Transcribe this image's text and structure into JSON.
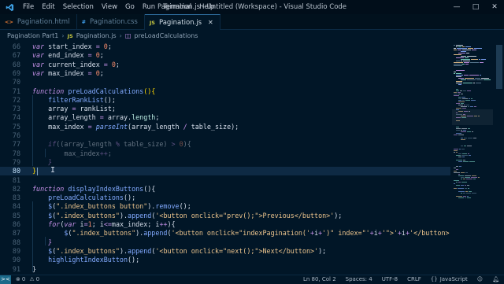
{
  "window": {
    "title": "Pagination.js - Untitled (Workspace) - Visual Studio Code"
  },
  "menu": [
    "File",
    "Edit",
    "Selection",
    "View",
    "Go",
    "Run",
    "Terminal",
    "Help"
  ],
  "tabs": [
    {
      "label": "Pagination.html",
      "icon": "html-file-icon",
      "active": false
    },
    {
      "label": "Pagination.css",
      "icon": "css-file-icon",
      "active": false
    },
    {
      "label": "Pagination.js",
      "icon": "js-file-icon",
      "active": true
    }
  ],
  "breadcrumbs": [
    "Pagination Part1",
    "Pagination.js",
    "preLoadCalculations"
  ],
  "editor": {
    "current_line": 80,
    "lines": [
      {
        "n": "66",
        "tokens": [
          [
            "kw",
            "var"
          ],
          [
            "vr",
            " start_index "
          ],
          [
            "op",
            "="
          ],
          [
            "pn",
            " "
          ],
          [
            "num",
            "0"
          ],
          [
            "pn",
            ";"
          ]
        ]
      },
      {
        "n": "67",
        "tokens": [
          [
            "kw",
            "var"
          ],
          [
            "vr",
            " end_index "
          ],
          [
            "op",
            "="
          ],
          [
            "pn",
            " "
          ],
          [
            "num",
            "0"
          ],
          [
            "pn",
            ";"
          ]
        ]
      },
      {
        "n": "68",
        "tokens": [
          [
            "kw",
            "var"
          ],
          [
            "vr",
            " current_index "
          ],
          [
            "op",
            "="
          ],
          [
            "pn",
            " "
          ],
          [
            "num",
            "0"
          ],
          [
            "pn",
            ";"
          ]
        ]
      },
      {
        "n": "69",
        "tokens": [
          [
            "kw",
            "var"
          ],
          [
            "vr",
            " max_index "
          ],
          [
            "op",
            "="
          ],
          [
            "pn",
            " "
          ],
          [
            "num",
            "0"
          ],
          [
            "pn",
            ";"
          ]
        ]
      },
      {
        "n": "70",
        "tokens": []
      },
      {
        "n": "71",
        "tokens": [
          [
            "kw",
            "function"
          ],
          [
            "pn",
            " "
          ],
          [
            "fn",
            "preLoadCalculations"
          ],
          [
            "br",
            "()"
          ],
          [
            "br",
            "{"
          ]
        ]
      },
      {
        "n": "72",
        "tokens": [
          [
            "pn",
            "    "
          ],
          [
            "fn",
            "filterRankList"
          ],
          [
            "pn",
            "();"
          ]
        ]
      },
      {
        "n": "73",
        "tokens": [
          [
            "pn",
            "    "
          ],
          [
            "vr",
            "array "
          ],
          [
            "op",
            "="
          ],
          [
            "vr",
            " rankList"
          ],
          [
            "pn",
            ";"
          ]
        ]
      },
      {
        "n": "74",
        "tokens": [
          [
            "pn",
            "    "
          ],
          [
            "vr",
            "array_length "
          ],
          [
            "op",
            "="
          ],
          [
            "vr",
            " array"
          ],
          [
            "pn",
            "."
          ],
          [
            "pr",
            "length"
          ],
          [
            "pn",
            ";"
          ]
        ]
      },
      {
        "n": "75",
        "tokens": [
          [
            "pn",
            "    "
          ],
          [
            "vr",
            "max_index "
          ],
          [
            "op",
            "="
          ],
          [
            "pn",
            " "
          ],
          [
            "fnc",
            "parseInt"
          ],
          [
            "pn",
            "(array_length "
          ],
          [
            "op",
            "/"
          ],
          [
            "pn",
            " table_size);"
          ]
        ]
      },
      {
        "n": "76",
        "tokens": []
      },
      {
        "n": "77",
        "tokens": [
          [
            "pn",
            "    "
          ],
          [
            "kw",
            "if"
          ],
          [
            "pn",
            "((array_length "
          ],
          [
            "op",
            "%"
          ],
          [
            "pn",
            " table_size) "
          ],
          [
            "op",
            ">"
          ],
          [
            "pn",
            " "
          ],
          [
            "num",
            "0"
          ],
          [
            "pn",
            "){"
          ]
        ],
        "dim": true
      },
      {
        "n": "78",
        "tokens": [
          [
            "pn",
            "        "
          ],
          [
            "vr",
            "max_index"
          ],
          [
            "op",
            "++"
          ],
          [
            "pn",
            ";"
          ]
        ],
        "dim": true
      },
      {
        "n": "79",
        "tokens": [
          [
            "pn",
            "    "
          ],
          [
            "kw",
            "}"
          ]
        ],
        "dim": true
      },
      {
        "n": "80",
        "tokens": [
          [
            "br",
            "}"
          ]
        ]
      },
      {
        "n": "81",
        "tokens": []
      },
      {
        "n": "82",
        "tokens": [
          [
            "kw",
            "function"
          ],
          [
            "pn",
            " "
          ],
          [
            "fn",
            "displayIndexButtons"
          ],
          [
            "pn",
            "(){"
          ]
        ]
      },
      {
        "n": "83",
        "tokens": [
          [
            "pn",
            "    "
          ],
          [
            "fn",
            "preLoadCalculations"
          ],
          [
            "pn",
            "();"
          ]
        ]
      },
      {
        "n": "84",
        "tokens": [
          [
            "pn",
            "    "
          ],
          [
            "fn",
            "$"
          ],
          [
            "pn",
            "("
          ],
          [
            "str",
            "\".index_buttons button\""
          ],
          [
            "pn",
            ")."
          ],
          [
            "fn",
            "remove"
          ],
          [
            "pn",
            "();"
          ]
        ]
      },
      {
        "n": "85",
        "tokens": [
          [
            "pn",
            "    "
          ],
          [
            "fn",
            "$"
          ],
          [
            "pn",
            "("
          ],
          [
            "str",
            "\".index_buttons\""
          ],
          [
            "pn",
            ")."
          ],
          [
            "fn",
            "append"
          ],
          [
            "pn",
            "("
          ],
          [
            "str",
            "'<button onclick=\"prev();\">Previous</button>'"
          ],
          [
            "pn",
            ");"
          ]
        ]
      },
      {
        "n": "86",
        "tokens": [
          [
            "pn",
            "    "
          ],
          [
            "kw",
            "for"
          ],
          [
            "pn",
            "("
          ],
          [
            "kw",
            "var"
          ],
          [
            "pn",
            " i"
          ],
          [
            "op",
            "="
          ],
          [
            "num",
            "1"
          ],
          [
            "pn",
            "; i"
          ],
          [
            "op",
            "<="
          ],
          [
            "pn",
            "max_index; i"
          ],
          [
            "op",
            "++"
          ],
          [
            "pn",
            "){"
          ]
        ]
      },
      {
        "n": "87",
        "tokens": [
          [
            "pn",
            "        "
          ],
          [
            "fn",
            "$"
          ],
          [
            "pn",
            "("
          ],
          [
            "str",
            "\".index_buttons\""
          ],
          [
            "pn",
            ")."
          ],
          [
            "fn",
            "append"
          ],
          [
            "pn",
            "("
          ],
          [
            "str",
            "'<button onclick=\"indexPagination('"
          ],
          [
            "op",
            "+"
          ],
          [
            "pn",
            "i"
          ],
          [
            "op",
            "+"
          ],
          [
            "str",
            "')\" index=\"'"
          ],
          [
            "op",
            "+"
          ],
          [
            "pn",
            "i"
          ],
          [
            "op",
            "+"
          ],
          [
            "str",
            "'\">'"
          ],
          [
            "op",
            "+"
          ],
          [
            "pn",
            "i"
          ],
          [
            "op",
            "+"
          ],
          [
            "str",
            "'</button>'"
          ],
          [
            "pn",
            ");"
          ]
        ]
      },
      {
        "n": "88",
        "tokens": [
          [
            "pn",
            "    "
          ],
          [
            "kw",
            "}"
          ]
        ]
      },
      {
        "n": "89",
        "tokens": [
          [
            "pn",
            "    "
          ],
          [
            "fn",
            "$"
          ],
          [
            "pn",
            "("
          ],
          [
            "str",
            "\".index_buttons\""
          ],
          [
            "pn",
            ")."
          ],
          [
            "fn",
            "append"
          ],
          [
            "pn",
            "("
          ],
          [
            "str",
            "'<button onclick=\"next();\">Next</button>'"
          ],
          [
            "pn",
            ");"
          ]
        ]
      },
      {
        "n": "90",
        "tokens": [
          [
            "pn",
            "    "
          ],
          [
            "fn",
            "highlightIndexButton"
          ],
          [
            "pn",
            "();"
          ]
        ]
      },
      {
        "n": "91",
        "tokens": [
          [
            "pn",
            "}"
          ]
        ]
      }
    ]
  },
  "status": {
    "position": "Ln 80, Col 2",
    "spaces": "Spaces: 4",
    "encoding": "UTF-8",
    "eol": "CRLF",
    "language": "JavaScript",
    "remote_icon": "remote-icon",
    "errors": "0",
    "warnings": "0"
  },
  "colors": {
    "bg": "#011627",
    "accent": "#82aaff",
    "keyword": "#c792ea",
    "string": "#ecc48d",
    "number": "#f78c6c"
  }
}
